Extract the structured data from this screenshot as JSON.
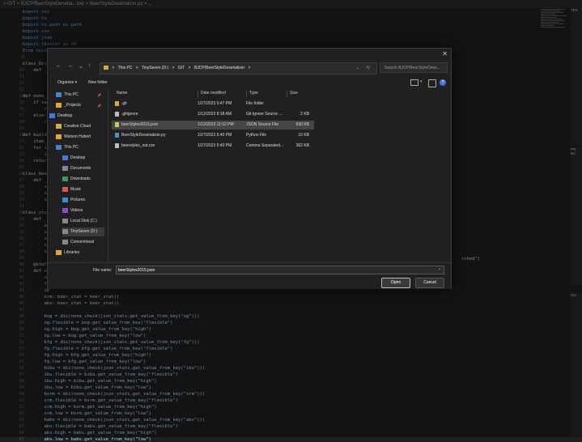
{
  "editor": {
    "tab_path": "> GIT > BJCP/BeerStyleDeseria...izer > BeerStyleDeserializer.py > ...",
    "lines": [
      {
        "n": "1",
        "t": "import csv",
        "c": "kw"
      },
      {
        "n": "2",
        "t": "import os",
        "c": "kw"
      },
      {
        "n": "3",
        "t": "import os.path as path",
        "c": "kw"
      },
      {
        "n": "4",
        "t": "import csv",
        "c": "kw"
      },
      {
        "n": "5",
        "t": "import json",
        "c": "kw"
      },
      {
        "n": "6",
        "t": "import tkinter as tk",
        "c": "kw"
      },
      {
        "n": "7",
        "t": "from tkinter",
        "c": "kw"
      },
      {
        "n": "8",
        "t": "",
        "c": ""
      },
      {
        "n": "9",
        "t": "class Di(",
        "c": ""
      },
      {
        "n": "10",
        "t": "    def _",
        "c": ""
      },
      {
        "n": "11",
        "t": "",
        "c": ""
      },
      {
        "n": "12",
        "t": "",
        "c": ""
      },
      {
        "n": "13",
        "t": "",
        "c": ""
      },
      {
        "n": "14",
        "t": "def none_c",
        "c": ""
      },
      {
        "n": "15",
        "t": "    if var",
        "c": ""
      },
      {
        "n": "16",
        "t": "        ret",
        "c": ""
      },
      {
        "n": "17",
        "t": "    else:",
        "c": ""
      },
      {
        "n": "18",
        "t": "        ret",
        "c": ""
      },
      {
        "n": "19",
        "t": "",
        "c": ""
      },
      {
        "n": "20",
        "t": "def build_",
        "c": ""
      },
      {
        "n": "21",
        "t": "    item_l",
        "c": ""
      },
      {
        "n": "22",
        "t": "    for it",
        "c": ""
      },
      {
        "n": "23",
        "t": "        it",
        "c": ""
      },
      {
        "n": "24",
        "t": "    return",
        "c": ""
      },
      {
        "n": "25",
        "t": "",
        "c": ""
      },
      {
        "n": "26",
        "t": "class beer_",
        "c": ""
      },
      {
        "n": "27",
        "t": "    def __",
        "c": ""
      },
      {
        "n": "28",
        "t": "        sel",
        "c": ""
      },
      {
        "n": "29",
        "t": "        sel",
        "c": ""
      },
      {
        "n": "30",
        "t": "        sel",
        "c": ""
      },
      {
        "n": "31",
        "t": "",
        "c": ""
      },
      {
        "n": "32",
        "t": "class styl",
        "c": ""
      },
      {
        "n": "33",
        "t": "    def __",
        "c": ""
      },
      {
        "n": "34",
        "t": "        ar",
        "c": ""
      },
      {
        "n": "35",
        "t": "        se",
        "c": ""
      },
      {
        "n": "36",
        "t": "        se",
        "c": ""
      },
      {
        "n": "37",
        "t": "        se",
        "c": ""
      },
      {
        "n": "38",
        "t": "        se",
        "c": ""
      },
      {
        "n": "39",
        "t": "",
        "c": ""
      },
      {
        "n": "40",
        "t": "    @static",
        "c": ""
      },
      {
        "n": "41",
        "t": "    def cre",
        "c": ""
      },
      {
        "n": "42",
        "t": "        og",
        "c": ""
      },
      {
        "n": "43",
        "t": "        fg",
        "c": ""
      },
      {
        "n": "44",
        "t": "        ib",
        "c": ""
      },
      {
        "n": "45",
        "t": "        srm: beer_stat = beer_stat()",
        "c": ""
      },
      {
        "n": "46",
        "t": "        abv: beer_stat = beer_stat()",
        "c": ""
      },
      {
        "n": "47",
        "t": "",
        "c": ""
      },
      {
        "n": "48",
        "t": "        bog = dic(none_check(json_stats.get_value_from_key(\"og\")))",
        "c": "blue"
      },
      {
        "n": "49",
        "t": "        og.flexible = bog.get_value_from_key(\"flexible\")",
        "c": "blue"
      },
      {
        "n": "50",
        "t": "        og.high = bog.get_value_from_key(\"high\")",
        "c": "blue"
      },
      {
        "n": "51",
        "t": "        og.low = bog.get_value_from_key(\"low\")",
        "c": "blue"
      },
      {
        "n": "52",
        "t": "        bfg = dic(none_check(json_stats.get_value_from_key(\"fg\")))",
        "c": "blue"
      },
      {
        "n": "53",
        "t": "        fg.flexible = bfg.get_value_from_key(\"flexible\")",
        "c": "blue"
      },
      {
        "n": "54",
        "t": "        fg.high = bfg.get_value_from_key(\"high\")",
        "c": "blue"
      },
      {
        "n": "55",
        "t": "        fg.low = bfg.get_value_from_key(\"low\")",
        "c": "blue"
      },
      {
        "n": "56",
        "t": "        bibu = dic(none_check(json_stats.get_value_from_key(\"ibu\")))",
        "c": "blue"
      },
      {
        "n": "57",
        "t": "        ibu.flexible = bibu.get_value_from_key(\"flexible\")",
        "c": "blue"
      },
      {
        "n": "58",
        "t": "        ibu.high = bibu.get_value_from_key(\"high\")",
        "c": "blue"
      },
      {
        "n": "59",
        "t": "        ibu.low = bibu.get_value_from_key(\"low\")",
        "c": "blue"
      },
      {
        "n": "60",
        "t": "        bsrm = dic(none_check(json_stats.get_value_from_key(\"srm\")))",
        "c": "blue"
      },
      {
        "n": "61",
        "t": "        srm.flexible = bsrm.get_value_from_key(\"flexible\")",
        "c": "blue"
      },
      {
        "n": "62",
        "t": "        srm.high = bsrm.get_value_from_key(\"high\")",
        "c": "blue"
      },
      {
        "n": "63",
        "t": "        srm.low = bsrm.get_value_from_key(\"low\")",
        "c": "blue"
      },
      {
        "n": "64",
        "t": "        babv = dic(none_check(json_stats.get_value_from_key(\"abv\")))",
        "c": "blue"
      },
      {
        "n": "65",
        "t": "        abv.flexible = babv.get_value_from_key(\"flexible\")",
        "c": "blue"
      },
      {
        "n": "66",
        "t": "        abv.high = babv.get_value_from_key(\"high\")",
        "c": "blue"
      },
      {
        "n": "67",
        "t": "        abv.low = babv.get_value_from_key(\"low\")",
        "c": "blue"
      }
    ],
    "overflow_text": "rched\")"
  },
  "right_panel": {
    "label_top": "TEX",
    "label_mid": "PR",
    "label_mid2": "No",
    "label_bot": "OU"
  },
  "dialog": {
    "close_glyph": "✕",
    "nav": {
      "back": "←",
      "forward": "→",
      "up_history": "⌄",
      "up": "↑",
      "refresh": "↻"
    },
    "address": [
      "This PC",
      ">",
      "TinySeven (D:)",
      ">",
      "GIT",
      ">",
      "BJCP/BeerStyleDeserializer",
      ">"
    ],
    "search_placeholder": "Search BJCP/BeerStyleDese...",
    "command_bar": {
      "organize": "Organize ▾",
      "new_folder": "New folder"
    },
    "tree": [
      {
        "label": "This PC",
        "icon": "#4a7fd4",
        "indent": 8,
        "pin": "📌",
        "sel": false
      },
      {
        "label": "_Projects",
        "icon": "#d9a93c",
        "indent": 8,
        "pin": "📌",
        "sel": false
      },
      {
        "label": "Desktop",
        "icon": "#3c7bd9",
        "indent": 0,
        "pin": "",
        "sel": false
      },
      {
        "label": "Creative Cloud",
        "icon": "#d9a93c",
        "indent": 8,
        "pin": "",
        "sel": false
      },
      {
        "label": "Watson Hubert",
        "icon": "#d9a93c",
        "indent": 8,
        "pin": "",
        "sel": false
      },
      {
        "label": "This PC",
        "icon": "#4a7fd4",
        "indent": 8,
        "pin": "",
        "sel": false
      },
      {
        "label": "Desktop",
        "icon": "#3c7bd9",
        "indent": 16,
        "pin": "",
        "sel": false
      },
      {
        "label": "Documents",
        "icon": "#888888",
        "indent": 16,
        "pin": "",
        "sel": false
      },
      {
        "label": "Downloads",
        "icon": "#2f9e5f",
        "indent": 16,
        "pin": "",
        "sel": false
      },
      {
        "label": "Music",
        "icon": "#d45a4a",
        "indent": 16,
        "pin": "",
        "sel": false
      },
      {
        "label": "Pictures",
        "icon": "#3c8bd9",
        "indent": 16,
        "pin": "",
        "sel": false
      },
      {
        "label": "Videos",
        "icon": "#8a4ad4",
        "indent": 16,
        "pin": "",
        "sel": false
      },
      {
        "label": "Local Disk (C:)",
        "icon": "#888888",
        "indent": 16,
        "pin": "",
        "sel": false
      },
      {
        "label": "TinySeven (D:)",
        "icon": "#888888",
        "indent": 16,
        "pin": "",
        "sel": true
      },
      {
        "label": "Conventional",
        "icon": "#888888",
        "indent": 16,
        "pin": "",
        "sel": false
      },
      {
        "label": "Libraries",
        "icon": "#d9a93c",
        "indent": 8,
        "pin": "",
        "sel": false
      }
    ],
    "columns": {
      "name": "Name",
      "date": "Date modified",
      "type": "Type",
      "size": "Size"
    },
    "files": [
      {
        "name": ".git",
        "date": "1/27/2023 5:47 PM",
        "type": "File folder",
        "size": "",
        "icon": "#d9a93c",
        "sel": false
      },
      {
        "name": ".gitignore",
        "date": "1/12/2023 8:18 AM",
        "type": "Git Ignore Source ...",
        "size": "2 KB",
        "icon": "#bbbbbb",
        "sel": false
      },
      {
        "name": "beerStyles2015.json",
        "date": "1/12/2023 11:52 PM",
        "type": "JSON Source File",
        "size": "630 KB",
        "icon": "#d4c84a",
        "sel": true
      },
      {
        "name": "BeerStyleDeserializer.py",
        "date": "1/27/2023 5:40 PM",
        "type": "Python File",
        "size": "10 KB",
        "icon": "#4a8fd4",
        "sel": false
      },
      {
        "name": "beerstyles_out.csv",
        "date": "1/27/2023 5:40 PM",
        "type": "Comma Separated...",
        "size": "362 KB",
        "icon": "#bbbbbb",
        "sel": false
      }
    ],
    "file_name_label": "File name:",
    "file_name_value": "beerStyles2015.json",
    "open_button": "Open",
    "cancel_button": "Cancel"
  }
}
